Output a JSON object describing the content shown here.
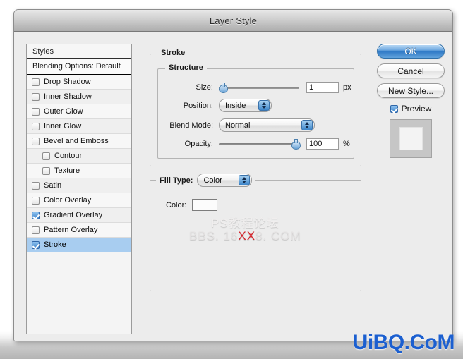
{
  "window": {
    "title": "Layer Style"
  },
  "styles_panel": {
    "header": "Styles",
    "blending_options": "Blending Options: Default",
    "items": [
      {
        "label": "Drop Shadow",
        "checked": false,
        "indent": false,
        "selected": false
      },
      {
        "label": "Inner Shadow",
        "checked": false,
        "indent": false,
        "selected": false
      },
      {
        "label": "Outer Glow",
        "checked": false,
        "indent": false,
        "selected": false
      },
      {
        "label": "Inner Glow",
        "checked": false,
        "indent": false,
        "selected": false
      },
      {
        "label": "Bevel and Emboss",
        "checked": false,
        "indent": false,
        "selected": false
      },
      {
        "label": "Contour",
        "checked": false,
        "indent": true,
        "selected": false
      },
      {
        "label": "Texture",
        "checked": false,
        "indent": true,
        "selected": false
      },
      {
        "label": "Satin",
        "checked": false,
        "indent": false,
        "selected": false
      },
      {
        "label": "Color Overlay",
        "checked": false,
        "indent": false,
        "selected": false
      },
      {
        "label": "Gradient Overlay",
        "checked": true,
        "indent": false,
        "selected": false
      },
      {
        "label": "Pattern Overlay",
        "checked": false,
        "indent": false,
        "selected": false
      },
      {
        "label": "Stroke",
        "checked": true,
        "indent": false,
        "selected": true
      }
    ]
  },
  "stroke_panel": {
    "legend": "Stroke",
    "structure": {
      "legend": "Structure",
      "size": {
        "label": "Size:",
        "value": "1",
        "unit": "px",
        "slider_percent": 2
      },
      "position": {
        "label": "Position:",
        "value": "Inside"
      },
      "blend_mode": {
        "label": "Blend Mode:",
        "value": "Normal"
      },
      "opacity": {
        "label": "Opacity:",
        "value": "100",
        "unit": "%",
        "slider_percent": 100
      }
    },
    "fill_type": {
      "legend_label": "Fill Type:",
      "value": "Color",
      "color": {
        "label": "Color:",
        "swatch_hex": "#fcfcfc"
      }
    }
  },
  "watermark": {
    "line1": "PS教程论坛",
    "line2_pre": "BBS. 16",
    "line2_hot": "XX",
    "line2_post": "8. COM"
  },
  "buttons": {
    "ok": "OK",
    "cancel": "Cancel",
    "new_style": "New Style..."
  },
  "preview": {
    "label": "Preview",
    "checked": true
  },
  "site_logo": "UiBQ.CoM",
  "colors": {
    "accent": "#2f79c6",
    "selection": "#a8cdf0",
    "watermark_hot": "#d6232a",
    "logo": "#1b5fd0"
  }
}
